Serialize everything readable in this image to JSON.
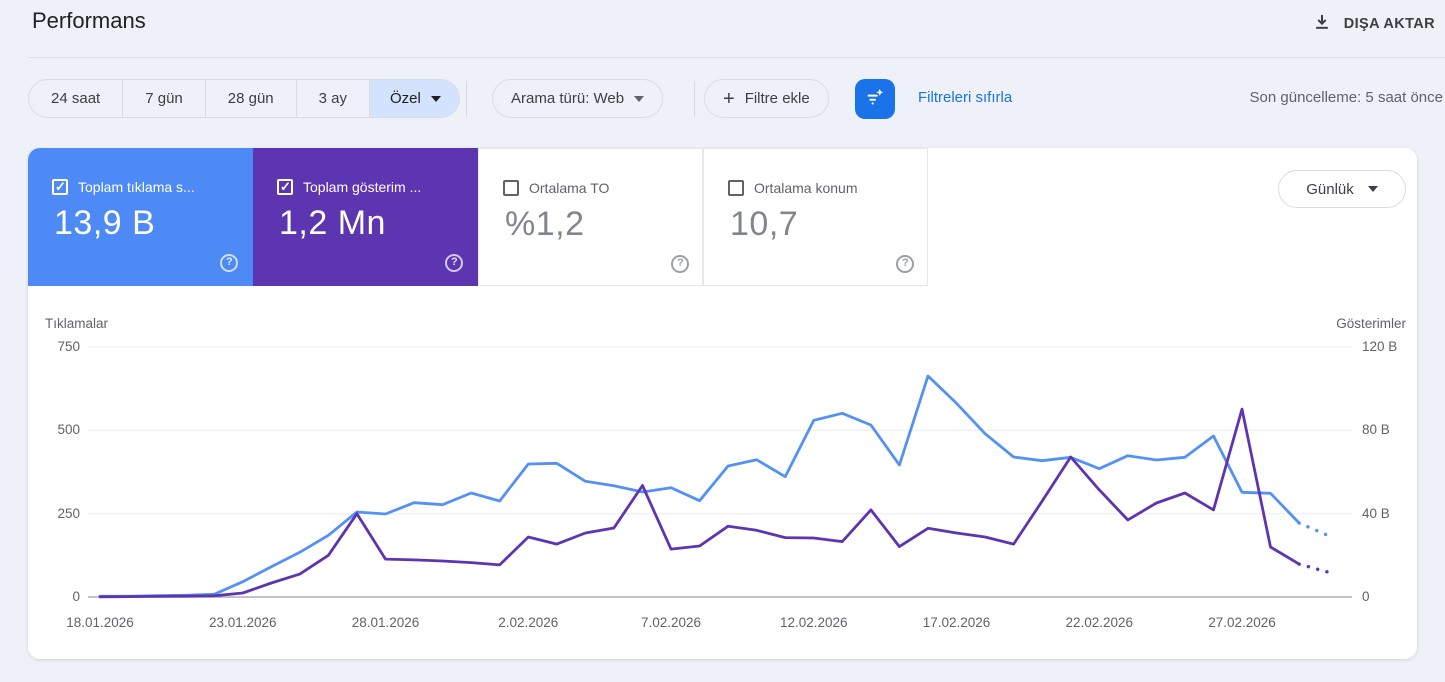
{
  "page": {
    "title": "Performans",
    "export_label": "DIŞA AKTAR",
    "last_update": "Son güncelleme: 5 saat önce"
  },
  "toolbar": {
    "date_ranges": [
      "24 saat",
      "7 gün",
      "28 gün",
      "3 ay"
    ],
    "custom_range_label": "Özel",
    "search_type_label": "Arama türü: Web",
    "add_filter_label": "Filtre ekle",
    "reset_filters_label": "Filtreleri sıfırla"
  },
  "metric_cards": [
    {
      "label": "Toplam tıklama s...",
      "value": "13,9 B",
      "checked": true,
      "color": "#4d8af5"
    },
    {
      "label": "Toplam gösterim ...",
      "value": "1,2 Mn",
      "checked": true,
      "color": "#5e35b1"
    },
    {
      "label": "Ortalama TO",
      "value": "%1,2",
      "checked": false,
      "color": ""
    },
    {
      "label": "Ortalama konum",
      "value": "10,7",
      "checked": false,
      "color": ""
    }
  ],
  "granularity_label": "Günlük",
  "chart_data": {
    "type": "line",
    "left_axis": {
      "title": "Tıklamalar",
      "ticks": [
        "750",
        "500",
        "250",
        "0"
      ],
      "max": 750
    },
    "right_axis": {
      "title": "Gösterimler",
      "ticks": [
        "120 B",
        "80 B",
        "40 B",
        "0"
      ],
      "max": 120
    },
    "x_tick_labels": [
      "18.01.2026",
      "23.01.2026",
      "28.01.2026",
      "2.02.2026",
      "7.02.2026",
      "12.02.2026",
      "17.02.2026",
      "22.02.2026",
      "27.02.2026"
    ],
    "dates": [
      "18.01.2026",
      "19.01.2026",
      "20.01.2026",
      "21.01.2026",
      "22.01.2026",
      "23.01.2026",
      "24.01.2026",
      "25.01.2026",
      "26.01.2026",
      "27.01.2026",
      "28.01.2026",
      "29.01.2026",
      "30.01.2026",
      "31.01.2026",
      "01.02.2026",
      "02.02.2026",
      "03.02.2026",
      "04.02.2026",
      "05.02.2026",
      "06.02.2026",
      "07.02.2026",
      "08.02.2026",
      "09.02.2026",
      "10.02.2026",
      "11.02.2026",
      "12.02.2026",
      "13.02.2026",
      "14.02.2026",
      "15.02.2026",
      "16.02.2026",
      "17.02.2026",
      "18.02.2026",
      "19.02.2026",
      "20.02.2026",
      "21.02.2026",
      "22.02.2026",
      "23.02.2026",
      "24.02.2026",
      "25.02.2026",
      "26.02.2026",
      "27.02.2026",
      "28.02.2026",
      "01.03.2026",
      "02.03.2026"
    ],
    "series": [
      {
        "name": "Tıklamalar",
        "axis": "left",
        "color": "#5491f5",
        "values": [
          2,
          2,
          4,
          5,
          8,
          46,
          91,
          134,
          185,
          255,
          249,
          283,
          277,
          312,
          288,
          399,
          401,
          347,
          334,
          315,
          328,
          289,
          393,
          412,
          361,
          530,
          551,
          516,
          396,
          663,
          581,
          490,
          420,
          409,
          419,
          385,
          424,
          411,
          419,
          483,
          314,
          311,
          222,
          185
        ]
      },
      {
        "name": "Gösterimler (B)",
        "axis": "right",
        "color": "#5e35b1",
        "values": [
          0.1,
          0.2,
          0.3,
          0.4,
          0.6,
          1.9,
          6.7,
          11,
          20,
          40,
          18.2,
          17.8,
          17.3,
          16.5,
          15.4,
          28.8,
          25.4,
          30.7,
          33.1,
          53.5,
          23,
          24.5,
          34,
          32,
          28.5,
          28.3,
          26.6,
          41.8,
          24.2,
          33,
          30.7,
          28.8,
          25.4,
          46,
          67.2,
          51.4,
          37,
          45.1,
          49.9,
          41.8,
          90.2,
          24,
          15.8,
          12
        ]
      }
    ],
    "dotted_tail_points": 1,
    "grid": "horizontal",
    "colors": {
      "grid": "#e9ebf0",
      "baseline": "#9aa0a6"
    }
  }
}
